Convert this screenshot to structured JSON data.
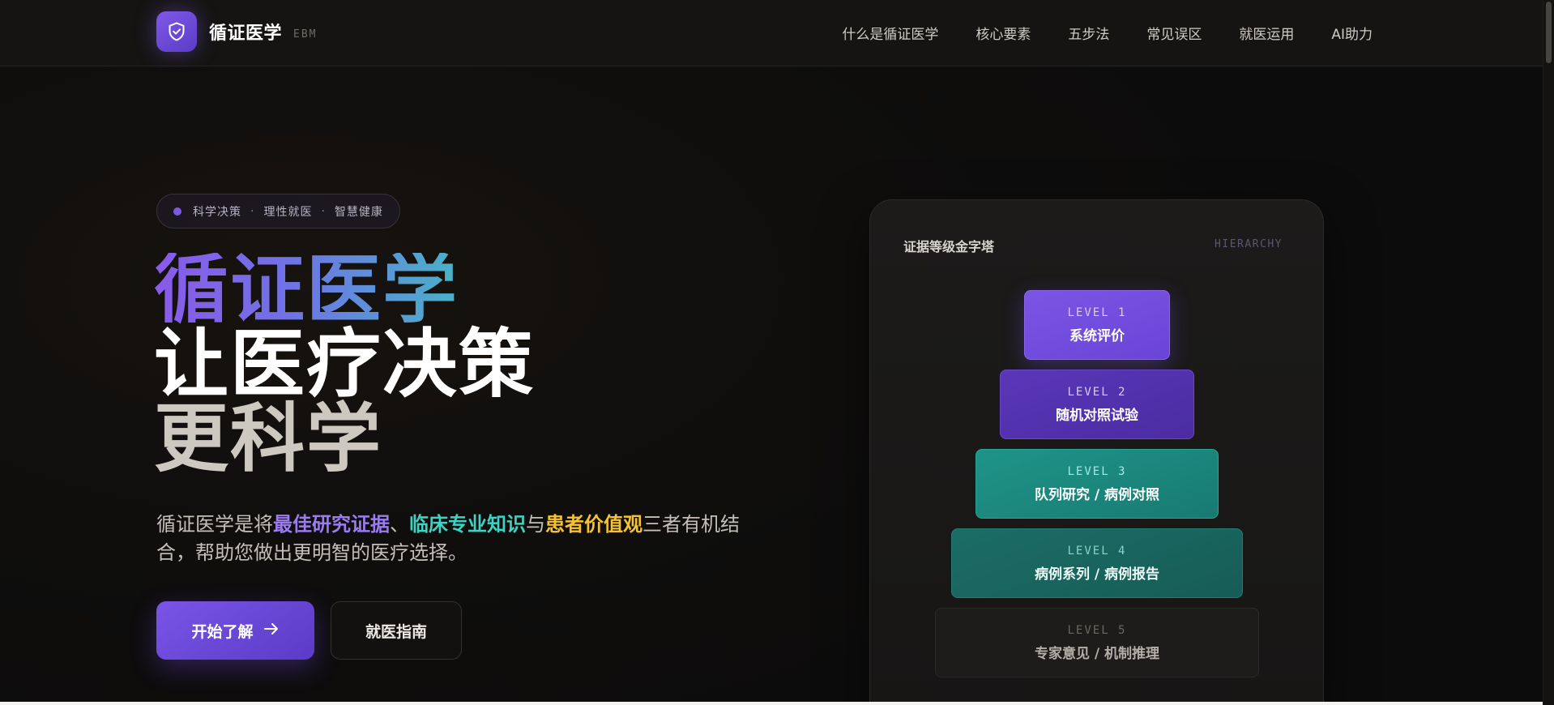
{
  "brand": {
    "name": "循证医学",
    "tag": "EBM",
    "icon": "shield-check-icon",
    "accent_color": "#7a55e6"
  },
  "nav": {
    "items": [
      {
        "label": "什么是循证医学"
      },
      {
        "label": "核心要素"
      },
      {
        "label": "五步法"
      },
      {
        "label": "常见误区"
      },
      {
        "label": "就医运用"
      },
      {
        "label": "AI助力"
      }
    ]
  },
  "hero": {
    "pill": {
      "items": [
        "科学决策",
        "理性就医",
        "智慧健康"
      ],
      "separator": "·"
    },
    "title": {
      "line1": "循证医学",
      "line2": "让医疗决策",
      "line3": "更科学"
    },
    "description": {
      "part1": "循证医学是将",
      "highlight1": "最佳研究证据",
      "sep1": "、",
      "highlight2": "临床专业知识",
      "sep2": "与",
      "highlight3": "患者价值观",
      "part2": "三者有机结合，帮助您做出更明智的医疗选择。"
    },
    "primary_button": {
      "label": "开始了解",
      "icon": "arrow-right-icon"
    },
    "secondary_button": {
      "label": "就医指南"
    }
  },
  "pyramid": {
    "title": "证据等级金字塔",
    "tag": "HIERARCHY",
    "levels": [
      {
        "code": "LEVEL 1",
        "name": "系统评价"
      },
      {
        "code": "LEVEL 2",
        "name": "随机对照试验"
      },
      {
        "code": "LEVEL 3",
        "name": "队列研究 / 病例对照"
      },
      {
        "code": "LEVEL 4",
        "name": "病例系列 / 病例报告"
      },
      {
        "code": "LEVEL 5",
        "name": "专家意见 / 机制推理"
      }
    ]
  },
  "colors": {
    "purple": "#9b7cf0",
    "teal": "#3fd1c2",
    "gold": "#f5c233"
  }
}
